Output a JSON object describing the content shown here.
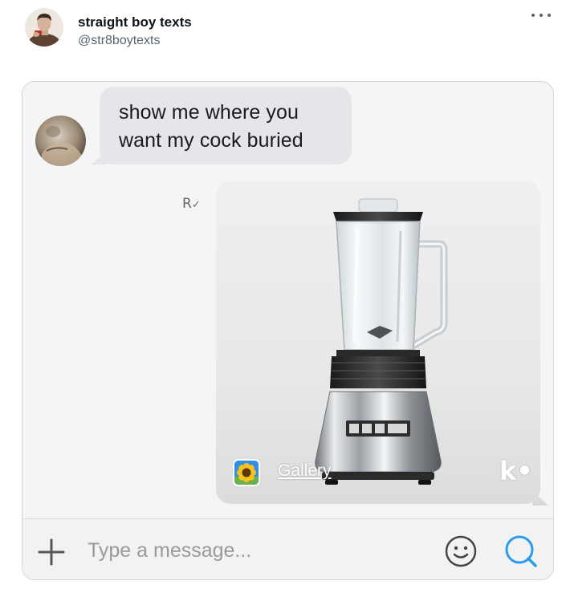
{
  "tweet": {
    "author_name": "straight boy texts",
    "author_handle": "@str8boytexts",
    "more_icon": "more-horizontal-icon"
  },
  "chat": {
    "incoming_message": "show me where you\nwant my cock buried",
    "read_receipt": "R",
    "media": {
      "image_subject": "blender",
      "source_icon": "sunflower-gallery-icon",
      "source_label": "Gallery",
      "brand": "k•"
    }
  },
  "compose": {
    "placeholder": "Type a message...",
    "value": "",
    "icons": [
      "plus-icon",
      "smiley-icon",
      "search-icon"
    ]
  },
  "colors": {
    "incoming_bubble": "#e4e6ea",
    "accent_blue": "#3aa8ff",
    "handle_gray": "#536471"
  }
}
